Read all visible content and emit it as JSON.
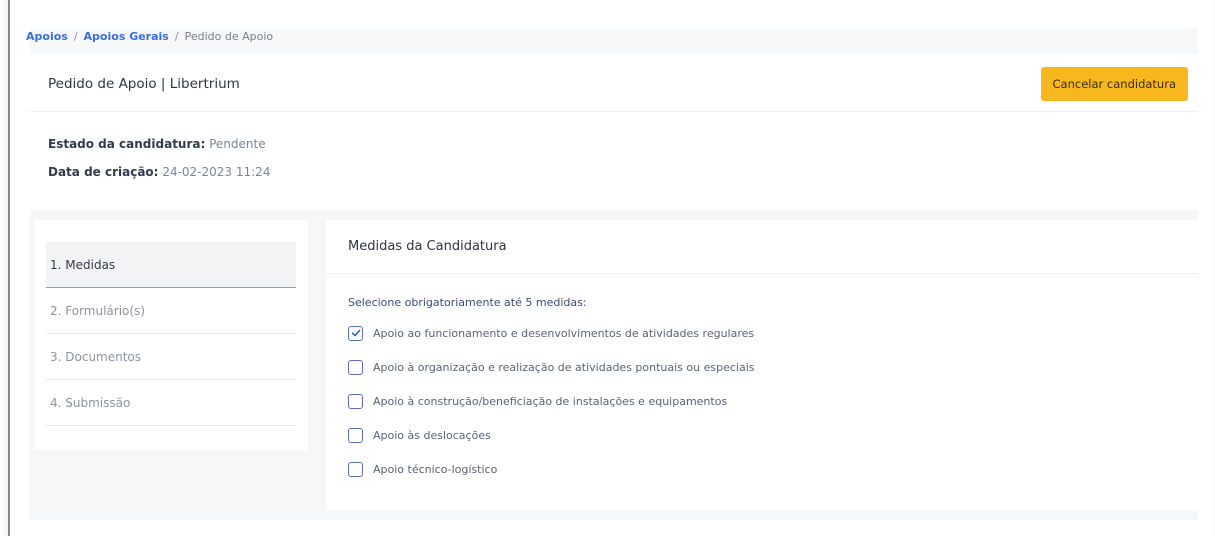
{
  "breadcrumb": {
    "items": [
      {
        "label": "Apoios"
      },
      {
        "label": "Apoios Gerais"
      }
    ],
    "current": "Pedido de Apoio",
    "separator": "/"
  },
  "header": {
    "title": "Pedido de Apoio | Libertrium",
    "cancel_label": "Cancelar candidatura"
  },
  "meta": {
    "estado_label": "Estado da candidatura:",
    "estado_value": "Pendente",
    "data_label": "Data de criação:",
    "data_value": "24-02-2023 11:24"
  },
  "steps": [
    {
      "label": "1. Medidas",
      "active": true
    },
    {
      "label": "2. Formulário(s)",
      "active": false
    },
    {
      "label": "3. Documentos",
      "active": false
    },
    {
      "label": "4. Submissão",
      "active": false
    }
  ],
  "main": {
    "title": "Medidas da Candidatura",
    "instruction": "Selecione obrigatoriamente até 5 medidas:",
    "options": [
      {
        "label": "Apoio ao funcionamento e desenvolvimentos de atividades regulares",
        "checked": true
      },
      {
        "label": "Apoio à organização e realização de atividades pontuais ou especiais",
        "checked": false
      },
      {
        "label": "Apoio à construção/beneficiação de instalações e equipamentos",
        "checked": false
      },
      {
        "label": "Apoio às deslocações",
        "checked": false
      },
      {
        "label": "Apoio técnico-logístico",
        "checked": false
      }
    ]
  },
  "colors": {
    "accent": "#f7b81d",
    "link": "#3b6fd8",
    "checkbox": "#5a6fb5"
  }
}
